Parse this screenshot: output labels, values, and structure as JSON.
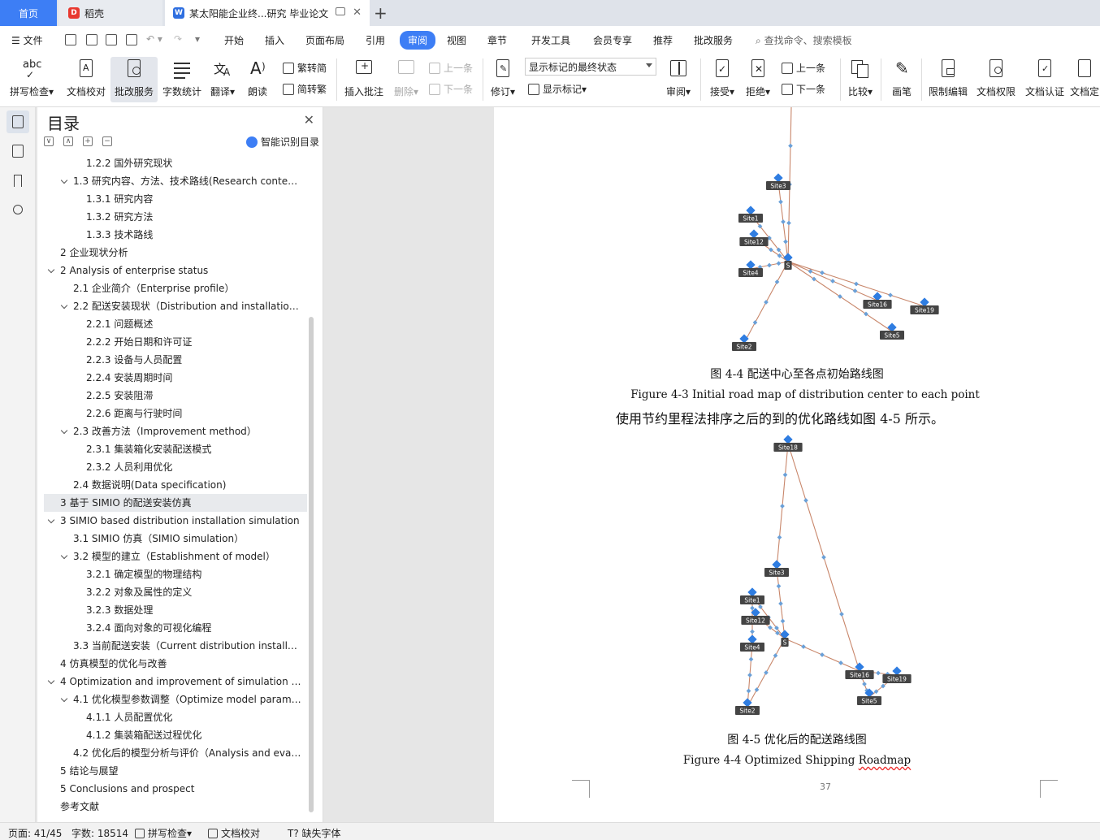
{
  "tabs": {
    "home": "首页",
    "daoke": "稻壳",
    "doc": "某太阳能企业终...研究 毕业论文"
  },
  "menu": {
    "file": "文件",
    "items": [
      "开始",
      "插入",
      "页面布局",
      "引用",
      "审阅",
      "视图",
      "章节",
      "开发工具",
      "会员专享",
      "推荐",
      "批改服务"
    ],
    "active": "审阅",
    "search_placeholder": "查找命令、搜索模板"
  },
  "ribbon": {
    "spell_check": "拼写检查",
    "doc_proof": "文档校对",
    "correction_service": "批改服务",
    "word_count": "字数统计",
    "translate": "翻译",
    "read_aloud": "朗读",
    "trad_to_simp": "繁转简",
    "simp_to_trad": "简转繁",
    "insert_comment": "插入批注",
    "delete": "删除",
    "prev": "上一条",
    "next": "下一条",
    "revise": "修订",
    "markup_state": "显示标记的最终状态",
    "show_markup": "显示标记",
    "review": "审阅",
    "accept": "接受",
    "reject": "拒绝",
    "prev2": "上一条",
    "next2": "下一条",
    "compare": "比较",
    "pen": "画笔",
    "restrict_edit": "限制编辑",
    "doc_permission": "文档权限",
    "doc_cert": "文档认证",
    "doc_final": "文档定"
  },
  "toc": {
    "title": "目录",
    "smart": "智能识别目录",
    "items": [
      {
        "text": "1.2.2  国外研究现状",
        "level": 3,
        "arrow": false
      },
      {
        "text": "1.3  研究内容、方法、技术路线(Research conten…",
        "level": 2,
        "arrow": true
      },
      {
        "text": "1.3.1  研究内容",
        "level": 3,
        "arrow": false
      },
      {
        "text": "1.3.2  研究方法",
        "level": 3,
        "arrow": false
      },
      {
        "text": "1.3.3  技术路线",
        "level": 3,
        "arrow": false
      },
      {
        "text": "2  企业现状分析",
        "level": 1,
        "arrow": false
      },
      {
        "text": "2 Analysis of enterprise status",
        "level": 1,
        "arrow": true
      },
      {
        "text": "2.1  企业简介（Enterprise profile）",
        "level": 2,
        "arrow": false
      },
      {
        "text": "2.2  配送安装现状（Distribution and installation…",
        "level": 2,
        "arrow": true
      },
      {
        "text": "2.2.1  问题概述",
        "level": 3,
        "arrow": false
      },
      {
        "text": "2.2.2  开始日期和许可证",
        "level": 3,
        "arrow": false
      },
      {
        "text": "2.2.3  设备与人员配置",
        "level": 3,
        "arrow": false
      },
      {
        "text": "2.2.4  安装周期时间",
        "level": 3,
        "arrow": false
      },
      {
        "text": "2.2.5  安装阻滞",
        "level": 3,
        "arrow": false
      },
      {
        "text": "2.2.6  距离与行驶时间",
        "level": 3,
        "arrow": false
      },
      {
        "text": "2.3  改善方法（Improvement method）",
        "level": 2,
        "arrow": true
      },
      {
        "text": "2.3.1  集装箱化安装配送模式",
        "level": 3,
        "arrow": false
      },
      {
        "text": "2.3.2  人员利用优化",
        "level": 3,
        "arrow": false
      },
      {
        "text": "2.4  数据说明(Data specification)",
        "level": 2,
        "arrow": false
      },
      {
        "text": "3  基于 SIMIO 的配送安装仿真",
        "level": 1,
        "arrow": false,
        "selected": true
      },
      {
        "text": "3 SIMIO based distribution installation simulation",
        "level": 1,
        "arrow": true
      },
      {
        "text": "3.1 SIMIO 仿真（SIMIO simulation）",
        "level": 2,
        "arrow": false
      },
      {
        "text": "3.2  模型的建立（Establishment of model）",
        "level": 2,
        "arrow": true
      },
      {
        "text": "3.2.1  确定模型的物理结构",
        "level": 3,
        "arrow": false
      },
      {
        "text": "3.2.2  对象及属性的定义",
        "level": 3,
        "arrow": false
      },
      {
        "text": "3.2.3  数据处理",
        "level": 3,
        "arrow": false
      },
      {
        "text": "3.2.4  面向对象的可视化编程",
        "level": 3,
        "arrow": false
      },
      {
        "text": "3.3  当前配送安装（Current distribution installa…",
        "level": 2,
        "arrow": false
      },
      {
        "text": "4  仿真模型的优化与改善",
        "level": 1,
        "arrow": false
      },
      {
        "text": "4 Optimization and improvement of simulation …",
        "level": 1,
        "arrow": true
      },
      {
        "text": "4.1  优化模型参数调整（Optimize model param…",
        "level": 2,
        "arrow": true
      },
      {
        "text": "4.1.1  人员配置优化",
        "level": 3,
        "arrow": false
      },
      {
        "text": "4.1.2  集装箱配送过程优化",
        "level": 3,
        "arrow": false
      },
      {
        "text": "4.2  优化后的模型分析与评价（Analysis and eval…",
        "level": 2,
        "arrow": false
      },
      {
        "text": "5  结论与展望",
        "level": 1,
        "arrow": false
      },
      {
        "text": "5 Conclusions and prospect",
        "level": 1,
        "arrow": false
      },
      {
        "text": "参考文献",
        "level": 1,
        "arrow": false
      }
    ]
  },
  "document": {
    "fig1_cn": "图 4-4  配送中心至各点初始路线图",
    "fig1_en": "Figure 4-3 Initial road map of distribution center to each point",
    "paragraph": "使用节约里程法排序之后的到的优化路线如图 4-5 所示。",
    "fig2_cn": "图 4-5  优化后的配送路线图",
    "fig2_en_a": "Figure 4-4 Optimized Shipping ",
    "fig2_en_b": "Roadmap",
    "page_number": "37",
    "map1_labels": [
      "Site3",
      "Site1",
      "Site12",
      "Site4",
      "S",
      "Site16",
      "Site19",
      "Site5",
      "Site2"
    ],
    "map2_labels": [
      "Site18",
      "Site3",
      "Site1",
      "Site12",
      "Site4",
      "S",
      "Site16",
      "Site19",
      "Site5",
      "Site2"
    ]
  },
  "status": {
    "page": "页面: 41/45",
    "words": "字数: 18514",
    "spell": "拼写检查",
    "proof": "文档校对",
    "missing_font": "缺失字体"
  },
  "colors": {
    "accent": "#3d7ef5",
    "route": "#c8866a",
    "node": "#2f7de1",
    "label_bg": "#444444"
  }
}
